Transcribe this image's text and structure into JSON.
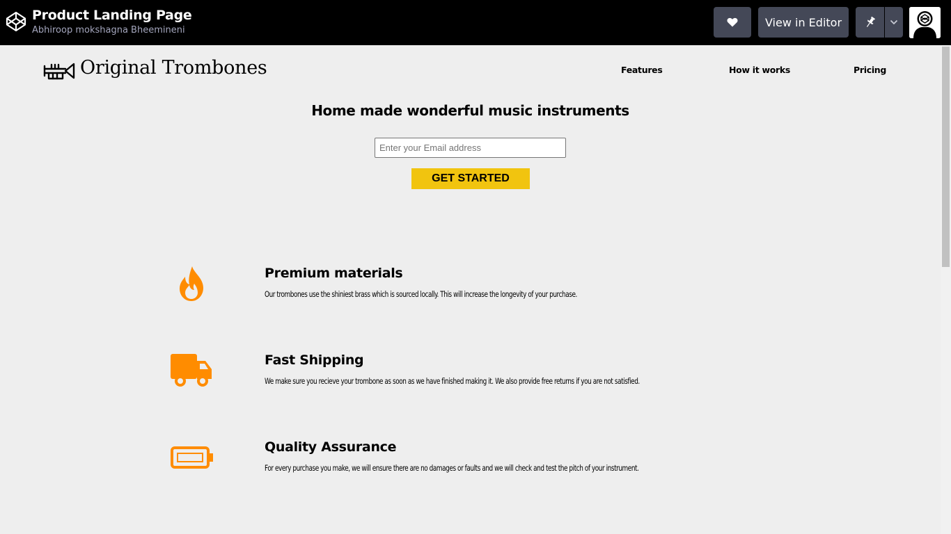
{
  "codepen": {
    "pen_title": "Product Landing Page",
    "author": "Abhiroop mokshagna Bheemineni",
    "view_in_editor_label": "View in Editor",
    "icons": {
      "logo": "codepen-logo-icon",
      "heart": "heart-icon",
      "pin": "pin-icon",
      "dropdown": "chevron-down-icon",
      "avatar": "avatar"
    }
  },
  "site": {
    "brand": "Original Trombones",
    "nav": [
      {
        "label": "Features"
      },
      {
        "label": "How it works"
      },
      {
        "label": "Pricing"
      }
    ],
    "hero": {
      "title": "Home made wonderful music instruments",
      "email_placeholder": "Enter your Email address",
      "cta_label": "GET STARTED"
    },
    "features": [
      {
        "icon": "fire-icon",
        "title": "Premium materials",
        "description": "Our trombones use the shiniest brass which is sourced locally. This will increase the longevity of your purchase."
      },
      {
        "icon": "truck-icon",
        "title": "Fast Shipping",
        "description": "We make sure you recieve your trombone as soon as we have finished making it. We also provide free returns if you are not satisfied."
      },
      {
        "icon": "battery-icon",
        "title": "Quality Assurance",
        "description": "For every purchase you make, we will ensure there are no damages or faults and we will check and test the pitch of your instrument."
      }
    ]
  },
  "colors": {
    "accent_orange": "#ff8c00",
    "cta_yellow": "#f1c40f",
    "topbar": "#000000",
    "button_gray": "#444857",
    "background": "#eeeeee"
  }
}
